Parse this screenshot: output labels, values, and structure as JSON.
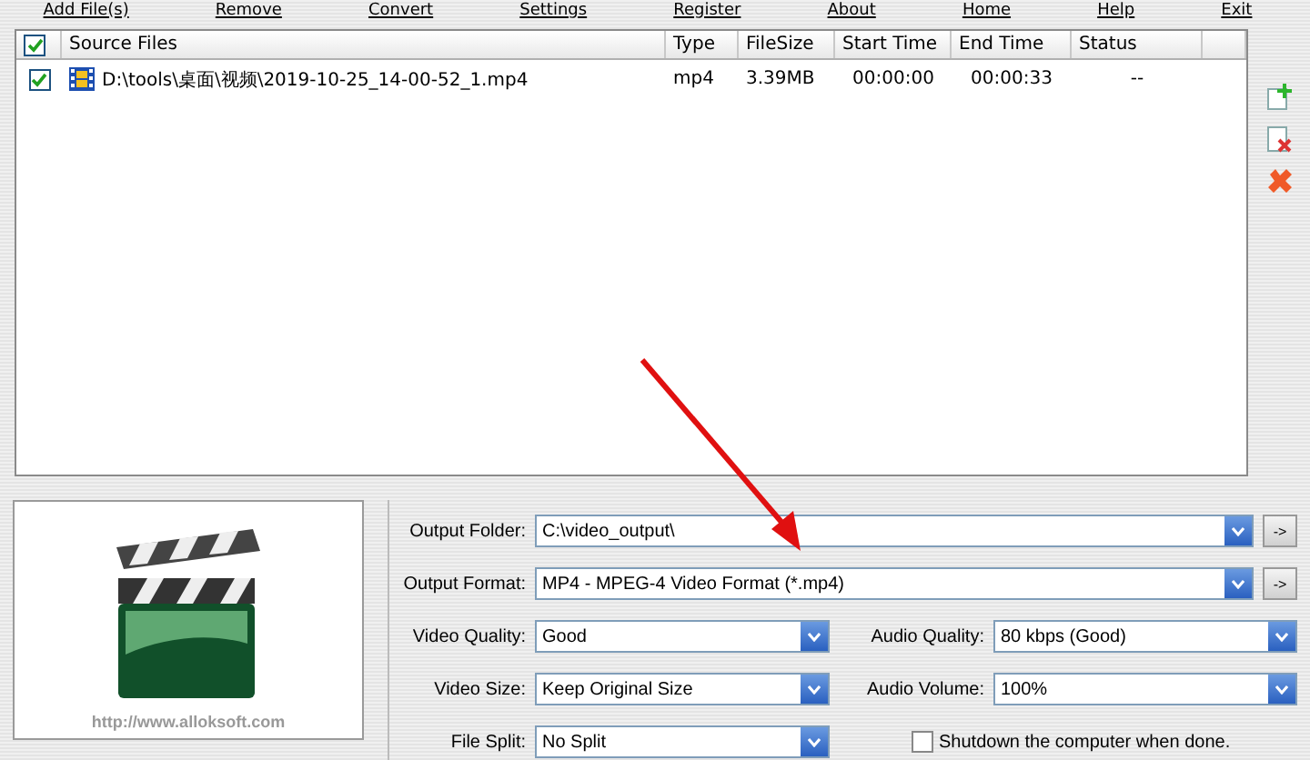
{
  "toolbar": [
    "Add File(s)",
    "Remove",
    "Convert",
    "Settings",
    "Register",
    "About",
    "Home",
    "Help",
    "Exit"
  ],
  "table": {
    "header_checked": true,
    "columns": [
      "Source Files",
      "Type",
      "FileSize",
      "Start Time",
      "End Time",
      "Status"
    ],
    "rows": [
      {
        "checked": true,
        "cells": [
          "D:\\tools\\桌面\\视频\\2019-10-25_14-00-52_1.mp4",
          "mp4",
          "3.39MB",
          "00:00:00",
          "00:00:33",
          "--"
        ]
      }
    ]
  },
  "preview": {
    "url": "http://www.alloksoft.com"
  },
  "output_folder": {
    "label": "Output Folder:",
    "value": "C:\\video_output\\",
    "go": "->"
  },
  "output_format": {
    "label": "Output Format:",
    "value": "MP4 - MPEG-4 Video Format (*.mp4)",
    "go": "->"
  },
  "video_quality": {
    "label": "Video Quality:",
    "value": "Good"
  },
  "audio_quality": {
    "label": "Audio Quality:",
    "value": "80  kbps (Good)"
  },
  "video_size": {
    "label": "Video Size:",
    "value": "Keep Original Size"
  },
  "audio_volume": {
    "label": "Audio Volume:",
    "value": "100%"
  },
  "file_split": {
    "label": "File Split:",
    "value": "No Split"
  },
  "shutdown": {
    "label": "Shutdown the computer when done.",
    "checked": false
  }
}
